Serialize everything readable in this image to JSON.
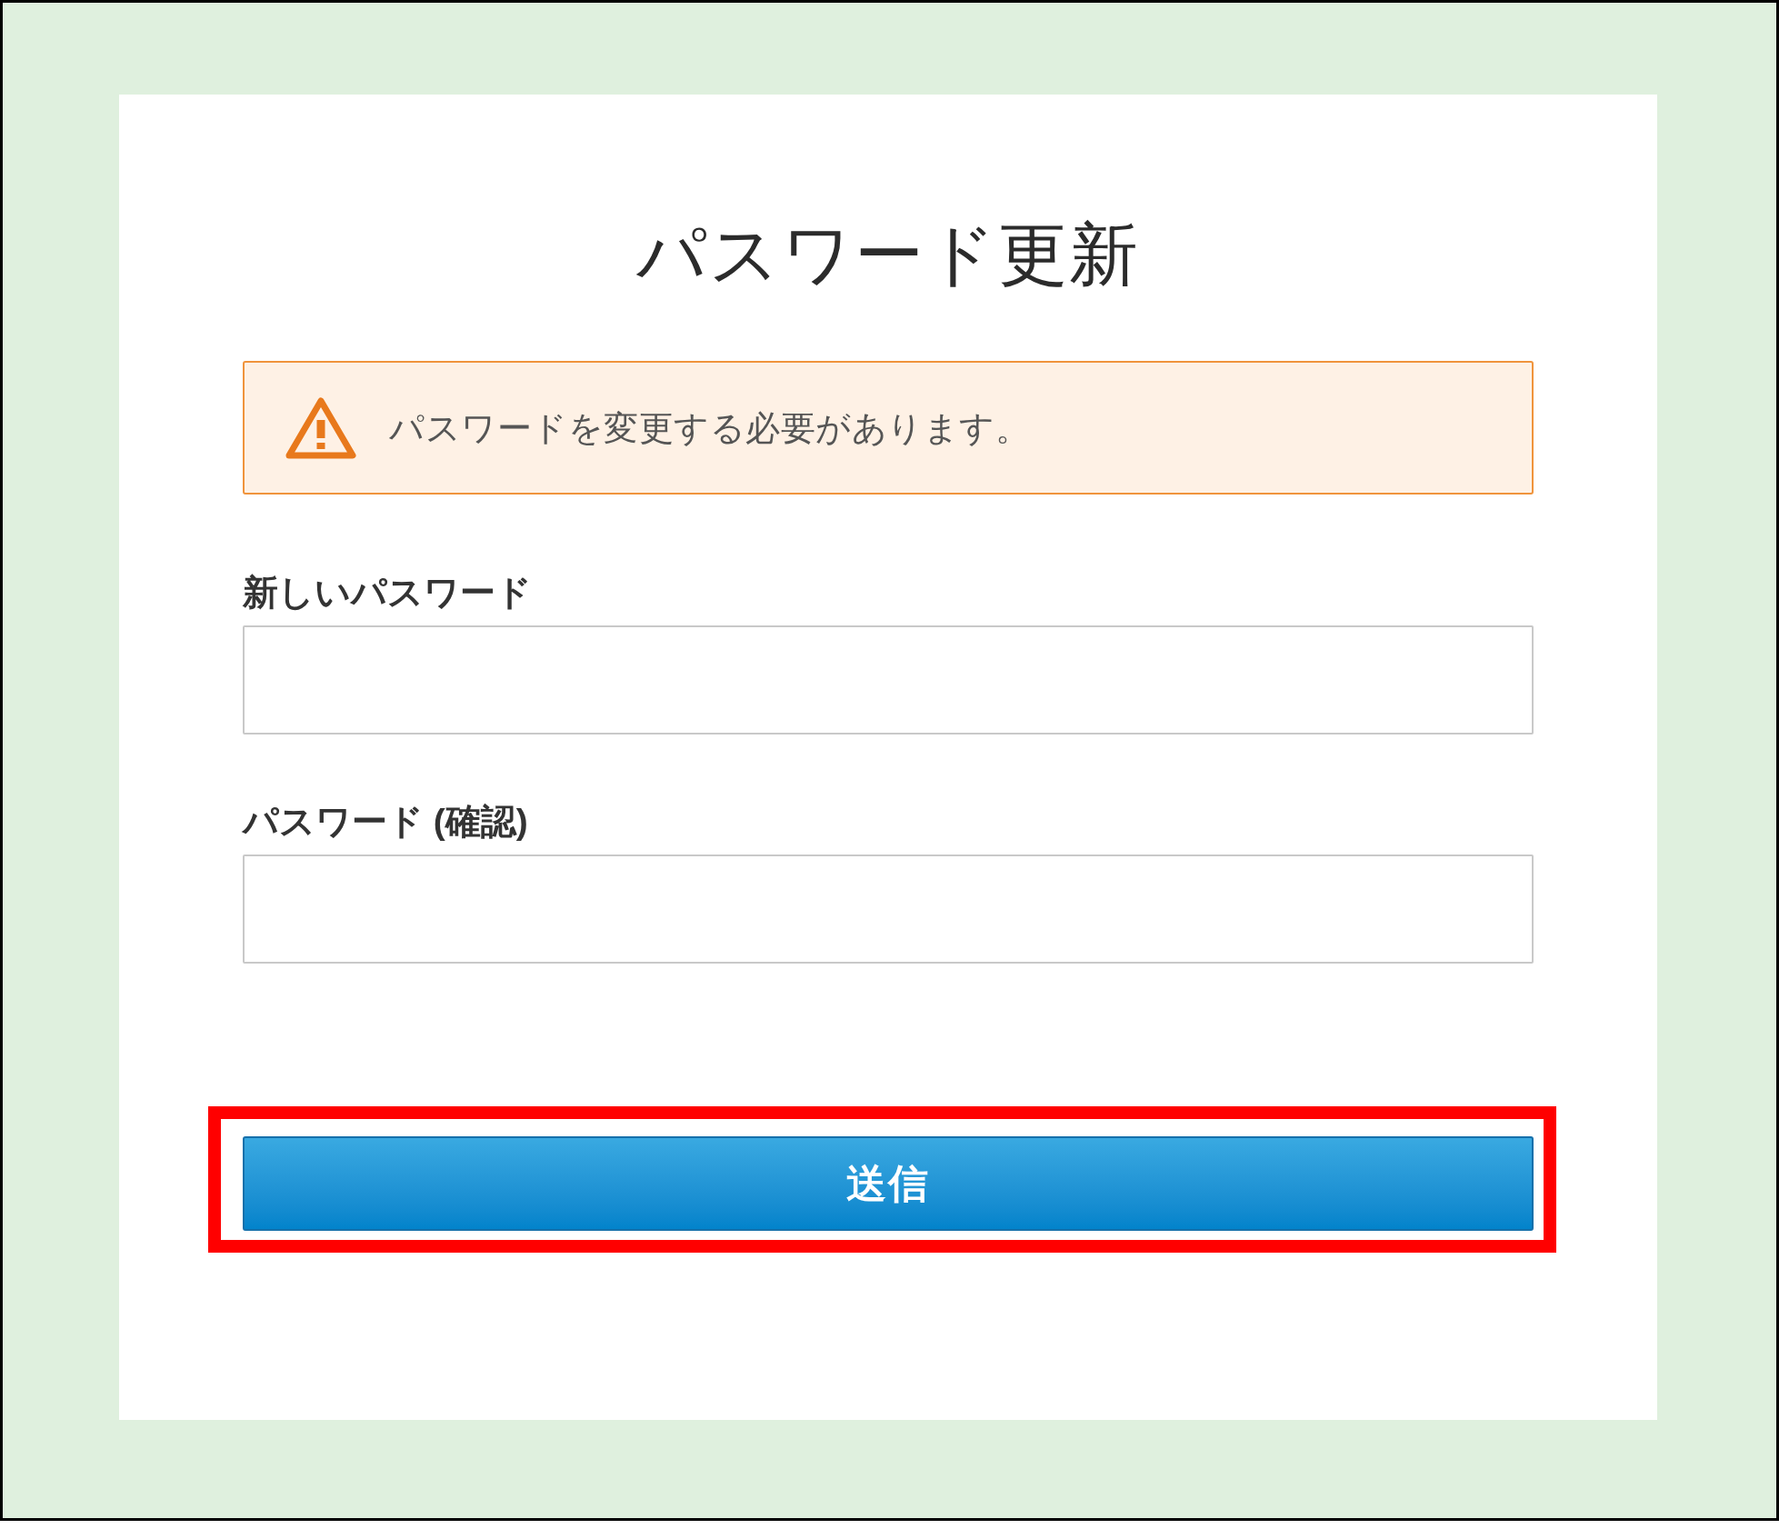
{
  "page": {
    "title": "パスワード更新"
  },
  "alert": {
    "kind": "warning",
    "message": "パスワードを変更する必要があります。"
  },
  "fields": [
    {
      "label": "新しいパスワード"
    },
    {
      "label": "パスワード (確認)"
    }
  ],
  "submit_button": {
    "label": "送信",
    "highlighted": true
  }
}
